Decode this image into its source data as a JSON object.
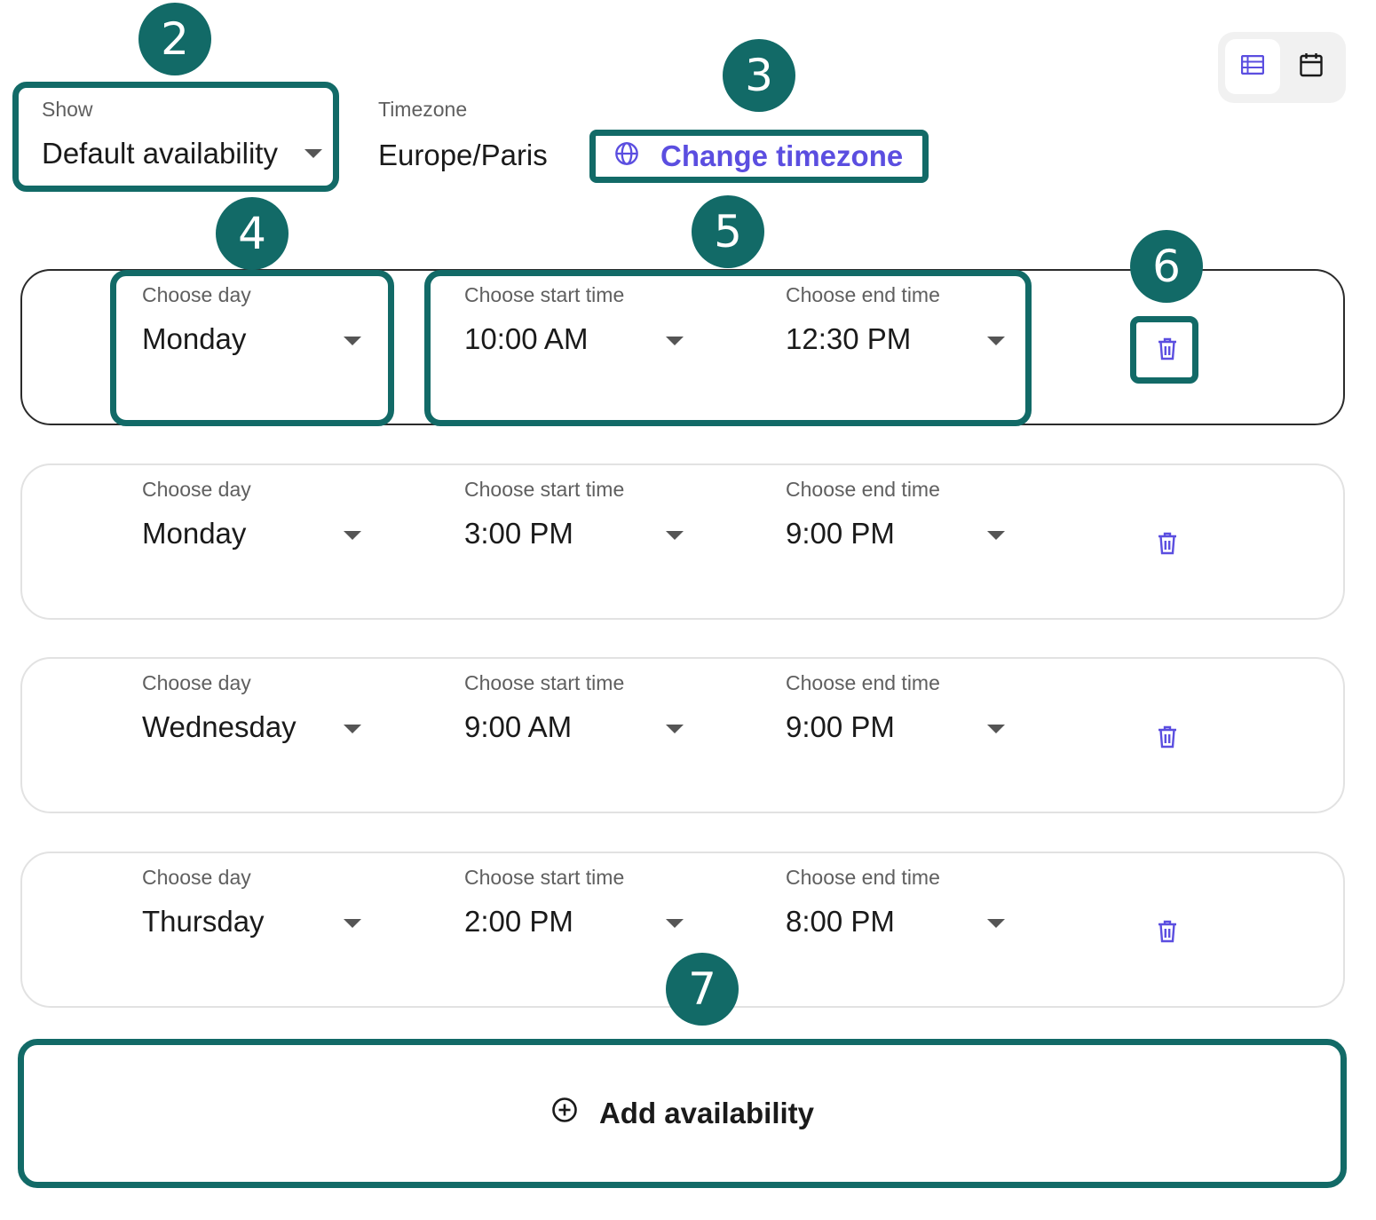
{
  "header": {
    "show_label": "Show",
    "show_value": "Default availability",
    "timezone_label": "Timezone",
    "timezone_value": "Europe/Paris",
    "change_timezone_label": "Change timezone"
  },
  "view_toggle": {
    "options": [
      "list-view",
      "calendar-view"
    ],
    "selected": "list-view"
  },
  "field_labels": {
    "day": "Choose day",
    "start": "Choose start time",
    "end": "Choose end time"
  },
  "rows": [
    {
      "day": "Monday",
      "start": "10:00 AM",
      "end": "12:30 PM"
    },
    {
      "day": "Monday",
      "start": "3:00 PM",
      "end": "9:00 PM"
    },
    {
      "day": "Wednesday",
      "start": "9:00 AM",
      "end": "9:00 PM"
    },
    {
      "day": "Thursday",
      "start": "2:00 PM",
      "end": "8:00 PM"
    }
  ],
  "add_availability_label": "Add availability",
  "annotations": [
    "2",
    "3",
    "4",
    "5",
    "6",
    "7"
  ],
  "colors": {
    "accent": "#5b4ee0",
    "annotation": "#126a67",
    "row_border": "#e2e2e2",
    "text": "#1a1a1a",
    "label": "#5f5f5f"
  }
}
